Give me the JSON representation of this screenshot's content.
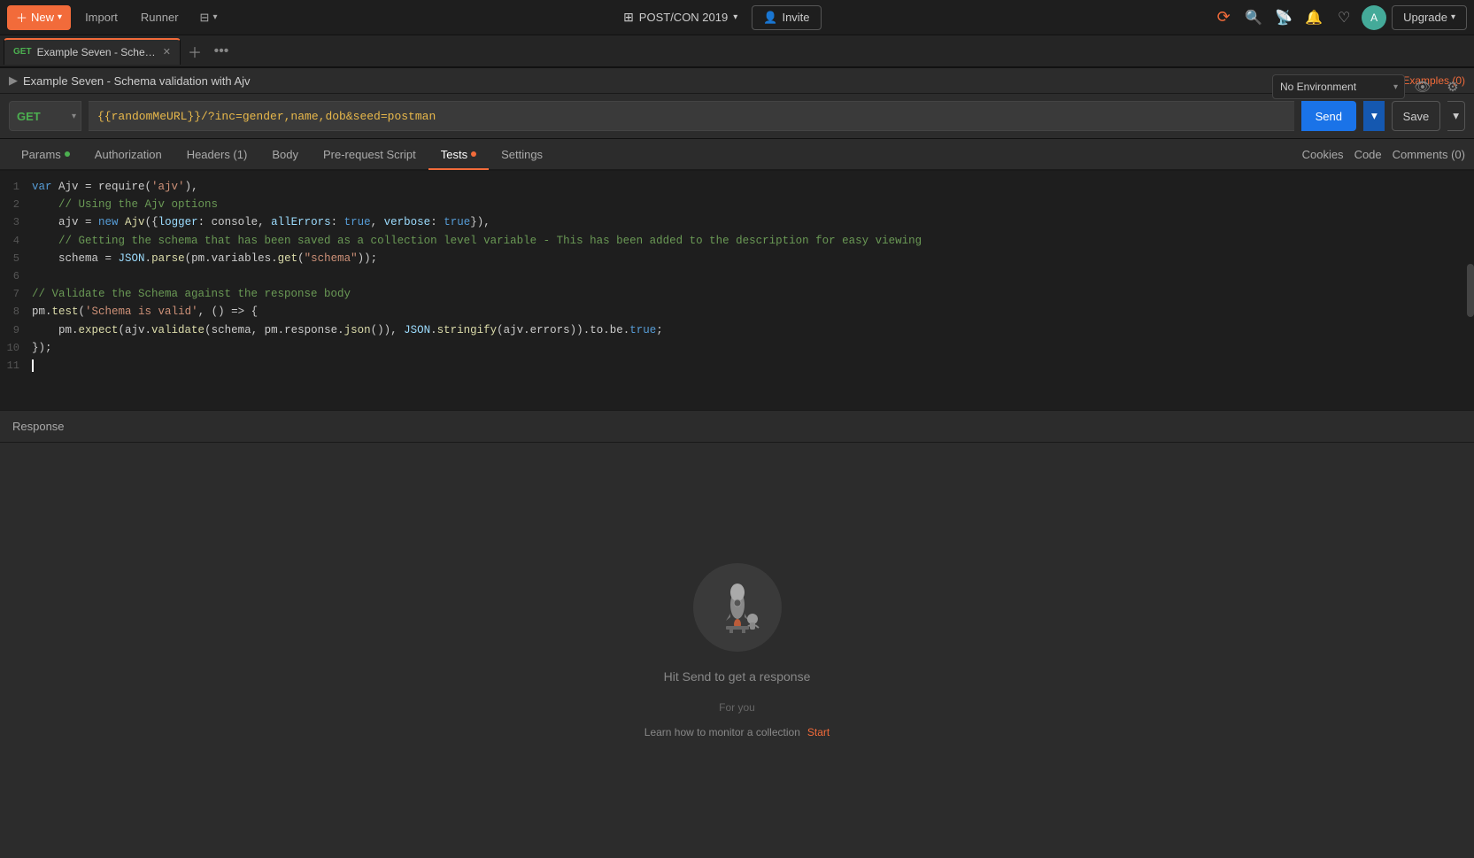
{
  "toolbar": {
    "new_label": "New",
    "import_label": "Import",
    "runner_label": "Runner",
    "workspace_label": "POST/CON 2019",
    "invite_label": "Invite",
    "upgrade_label": "Upgrade"
  },
  "tabs": [
    {
      "method": "GET",
      "title": "Example Seven - Schema valid...",
      "active": true
    }
  ],
  "env": {
    "placeholder": "No Environment"
  },
  "breadcrumb": {
    "title": "Example Seven - Schema validation with Ajv"
  },
  "examples_link": "Examples (0)",
  "request": {
    "method": "GET",
    "url": "{{randomMeURL}}/?inc=gender,name,dob&seed=postman",
    "send_label": "Send",
    "save_label": "Save"
  },
  "nav_tabs": [
    {
      "label": "Params",
      "dot": "green",
      "active": false
    },
    {
      "label": "Authorization",
      "dot": null,
      "active": false
    },
    {
      "label": "Headers (1)",
      "dot": null,
      "active": false
    },
    {
      "label": "Body",
      "dot": null,
      "active": false
    },
    {
      "label": "Pre-request Script",
      "dot": null,
      "active": false
    },
    {
      "label": "Tests",
      "dot": "orange",
      "active": true
    },
    {
      "label": "Settings",
      "dot": null,
      "active": false
    }
  ],
  "right_nav": {
    "cookies": "Cookies",
    "code": "Code",
    "comments": "Comments (0)"
  },
  "code": [
    {
      "num": 1,
      "content": "var Ajv = require('ajv'),"
    },
    {
      "num": 2,
      "content": "    // Using the Ajv options"
    },
    {
      "num": 3,
      "content": "    ajv = new Ajv({logger: console, allErrors: true, verbose: true}),"
    },
    {
      "num": 4,
      "content": "    // Getting the schema that has been saved as a collection level variable - This has been added to the description for easy viewing"
    },
    {
      "num": 5,
      "content": "    schema = JSON.parse(pm.variables.get(\"schema\"));"
    },
    {
      "num": 6,
      "content": ""
    },
    {
      "num": 7,
      "content": "// Validate the Schema against the response body"
    },
    {
      "num": 8,
      "content": "pm.test('Schema is valid', () => {"
    },
    {
      "num": 9,
      "content": "    pm.expect(ajv.validate(schema, pm.response.json()), JSON.stringify(ajv.errors)).to.be.true;"
    },
    {
      "num": 10,
      "content": "});"
    },
    {
      "num": 11,
      "content": ""
    }
  ],
  "response": {
    "header": "Response",
    "hit_send": "Hit Send to get a response",
    "for_you": "For you",
    "learn_label": "Learn how to monitor a collection",
    "start_label": "Start"
  }
}
